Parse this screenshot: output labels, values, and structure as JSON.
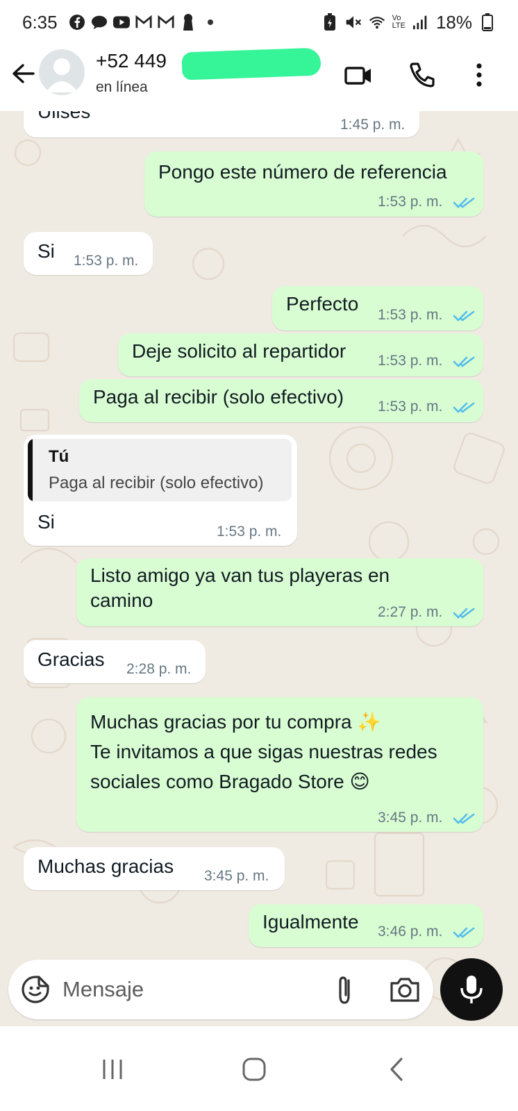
{
  "status_bar": {
    "time": "6:35",
    "battery": "18%",
    "network": "LTE",
    "network_top": "Vo",
    "left_icons": [
      "facebook-icon",
      "chat-icon",
      "youtube-icon",
      "gmail-icon",
      "gmail-icon",
      "keyhole-icon",
      "dot-icon"
    ],
    "right_icons": [
      "battery-saver-icon",
      "mute-icon",
      "wifi-icon",
      "volte-icon",
      "signal-icon",
      "battery-icon"
    ]
  },
  "header": {
    "phone": "+52 449",
    "status": "en línea",
    "icons": [
      "back-arrow-icon",
      "avatar-icon",
      "video-call-icon",
      "phone-call-icon",
      "more-vert-icon"
    ]
  },
  "messages": [
    {
      "dir": "in",
      "text": "Ulises",
      "time": "1:45 p. m."
    },
    {
      "dir": "out",
      "text": "Pongo este número de referencia",
      "time": "1:53 p. m.",
      "read": true
    },
    {
      "dir": "in",
      "text": "Si",
      "time": "1:53 p. m."
    },
    {
      "dir": "out",
      "text": "Perfecto",
      "time": "1:53 p. m.",
      "read": true
    },
    {
      "dir": "out",
      "text": "Deje solicito al repartidor",
      "time": "1:53 p. m.",
      "read": true
    },
    {
      "dir": "out",
      "text": "Paga al recibir (solo efectivo)",
      "time": "1:53 p. m.",
      "read": true
    },
    {
      "dir": "in",
      "quote_author": "Tú",
      "quote_text": "Paga al recibir (solo efectivo)",
      "text": "Si",
      "time": "1:53 p. m."
    },
    {
      "dir": "out",
      "text": "Listo amigo ya van tus playeras en\ncamino",
      "time": "2:27 p. m.",
      "read": true
    },
    {
      "dir": "in",
      "text": "Gracias",
      "time": "2:28 p. m."
    },
    {
      "dir": "out",
      "text": "Muchas gracias por tu compra ✨\nTe invitamos a que sigas nuestras redes\nsociales como Bragado Store 😊",
      "time": "3:45 p. m.",
      "read": true
    },
    {
      "dir": "in",
      "text": "Muchas gracias",
      "time": "3:45 p. m."
    },
    {
      "dir": "out",
      "text": "Igualmente",
      "time": "3:46 p. m.",
      "read": true
    }
  ],
  "composer": {
    "placeholder": "Mensaje",
    "icons": [
      "sticker-icon",
      "attach-icon",
      "camera-icon",
      "mic-icon"
    ]
  },
  "nav": {
    "icons": [
      "recent-apps-icon",
      "home-icon",
      "back-icon"
    ]
  },
  "colors": {
    "outgoing_bubble": "#d9fdd3",
    "incoming_bubble": "#ffffff",
    "chat_background": "#efeae2",
    "read_ticks": "#53bdeb",
    "redaction": "#35f598"
  }
}
